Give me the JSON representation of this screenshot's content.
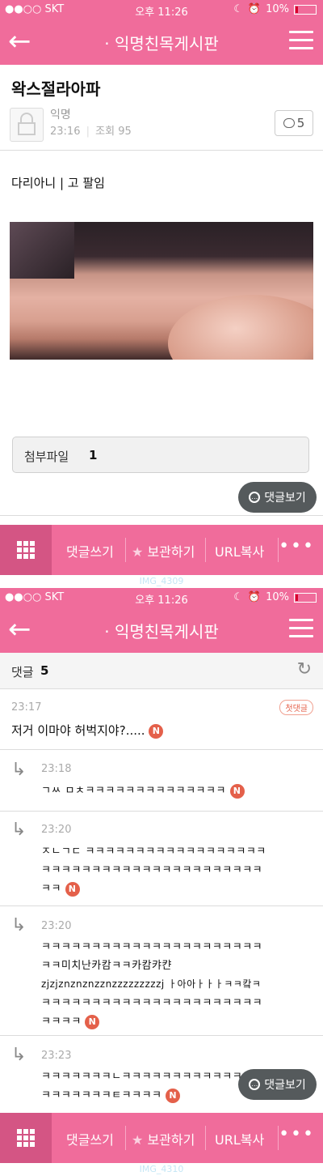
{
  "status_bar": {
    "carrier": "●●○○ SKT",
    "time": "오후 11:26",
    "battery": "10%"
  },
  "nav": {
    "back_icon": "arrow-left-icon",
    "title": "· 익명친목게시판",
    "menu_icon": "hamburger-icon"
  },
  "post": {
    "title": "왁스절라아파",
    "author": "익명",
    "time": "23:16",
    "views": "조회 95",
    "comment_count": "5",
    "body": "다리아니 | 고 팔임",
    "attachment_label": "첨부파일",
    "attachment_count": "1"
  },
  "fab_label": "댓글보기",
  "toolbar": {
    "write_comment": "댓글쓰기",
    "bookmark": "보관하기",
    "copy_url": "URL복사",
    "more": "•••"
  },
  "watermarks": {
    "first": "IMG_4309",
    "second": "IMG_4310"
  },
  "comments_header": {
    "label": "댓글",
    "count": "5"
  },
  "comments": [
    {
      "time": "23:17",
      "badge": "첫댓글",
      "text": "저거 이마야 허벅지야?....."
    },
    {
      "time": "23:18",
      "text": "ㄱㅆ ㅁㅊㅋㅋㅋㅋㅋㅋㅋㅋㅋㅋㅋㅋㅋㅋ"
    },
    {
      "time": "23:20",
      "lines": [
        "ㅈㄴㄱㄷ ㅋㅋㅋㅋㅋㅋㅋㅋㅋㅋㅋㅋㅋㅋㅋㅋㅋㅋ",
        "ㅋㅋㅋㅋㅋㅋㅋㅋㅋㅋㅋㅋㅋㅋㅋㅋㅋㅋㅋㅋㅋㅋ",
        "ㅋㅋ"
      ]
    },
    {
      "time": "23:20",
      "lines": [
        "ㅋㅋㅋㅋㅋㅋㅋㅋㅋㅋㅋㅋㅋㅋㅋㅋㅋㅋㅋㅋㅋㅋ",
        "ㅋㅋ미치난카캄ㅋㅋ카캄캬캰",
        "zjzjznznznzznzzzzzzzzzj ㅏ아아ㅏㅏㅏㅋㅋ캌ㅋ",
        "ㅋㅋㅋㅋㅋㅋㅋㅋㅋㅋㅋㅋㅋㅋㅋㅋㅋㅋㅋㅋㅋㅋ",
        "ㅋㅋㅋㅋ"
      ]
    },
    {
      "time": "23:23",
      "lines": [
        "ㅋㅋㅋㅋㅋㅋㅋㄴㅋㅋㅋㅋㅋㅋㅋㅋㅋㅋㅋㅋㅋ",
        "ㅋㅋㅋㅋㅋㅋㅋㅌㅋㅋㅋㅋ"
      ]
    }
  ],
  "new_badge": "N",
  "colors": {
    "brand_pink": "#f06c9b",
    "toolbar_dark": "#d45584",
    "new_badge": "#e4604a"
  }
}
